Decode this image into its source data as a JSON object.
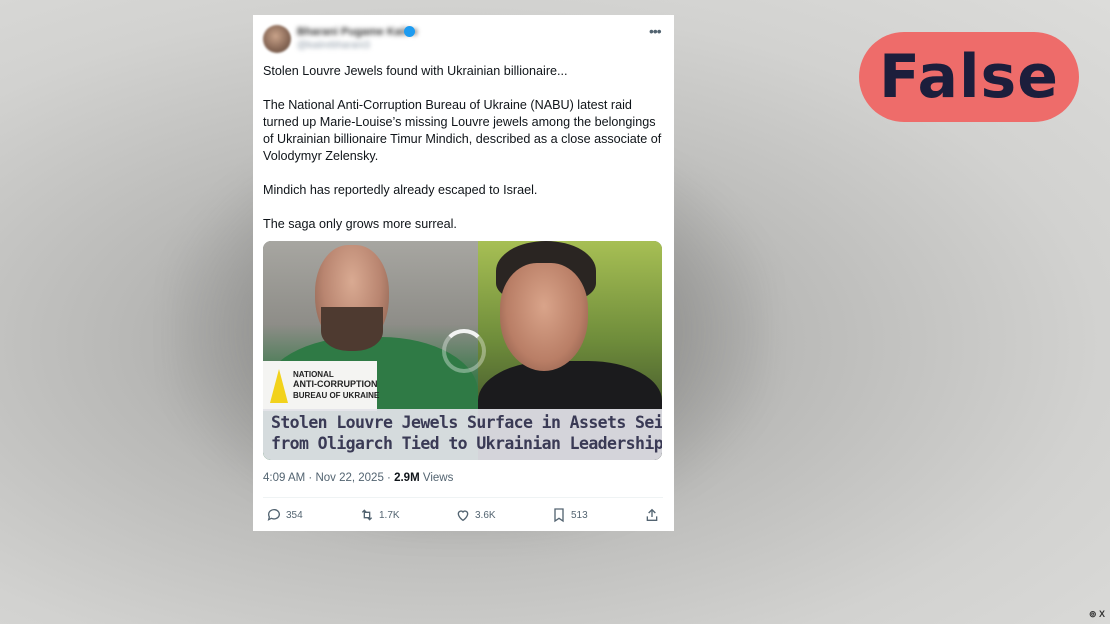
{
  "tweet": {
    "user_name": "Bharani Pugame Kaiire",
    "user_handle": "@kaiirebharani3",
    "paragraphs": [
      "Stolen Louvre Jewels found with Ukrainian billionaire...",
      "The National Anti-Corruption Bureau of Ukraine (NABU) latest raid turned up Marie-Louise’s missing Louvre jewels among the belongings of Ukrainian billionaire Timur Mindich, described as a close associate of Volodymyr Zelensky.",
      "Mindich has reportedly already escaped to Israel.",
      "The saga only grows more surreal."
    ],
    "media": {
      "logo_lines": [
        "NATIONAL",
        "ANTI-CORRUPTION",
        "BUREAU OF UKRAINE"
      ],
      "headline_lines": [
        "Stolen Louvre Jewels Surface in Assets Seized",
        "from Oligarch Tied to Ukrainian Leadership"
      ]
    },
    "meta": {
      "time": "4:09 AM",
      "separator": " · ",
      "date": "Nov 22, 2025",
      "views_count": "2.9M",
      "views_label": " Views"
    },
    "actions": {
      "replies": "354",
      "retweets": "1.7K",
      "likes": "3.6K",
      "bookmarks": "513"
    },
    "icons": [
      "verified-icon",
      "more-icon",
      "reply-icon",
      "retweet-icon",
      "like-icon",
      "bookmark-icon",
      "share-icon",
      "loading-icon"
    ]
  },
  "verdict": {
    "label": "False",
    "color": "#ee6c6a",
    "text_color": "#1c1e3c"
  },
  "watermark": "⊚ X"
}
